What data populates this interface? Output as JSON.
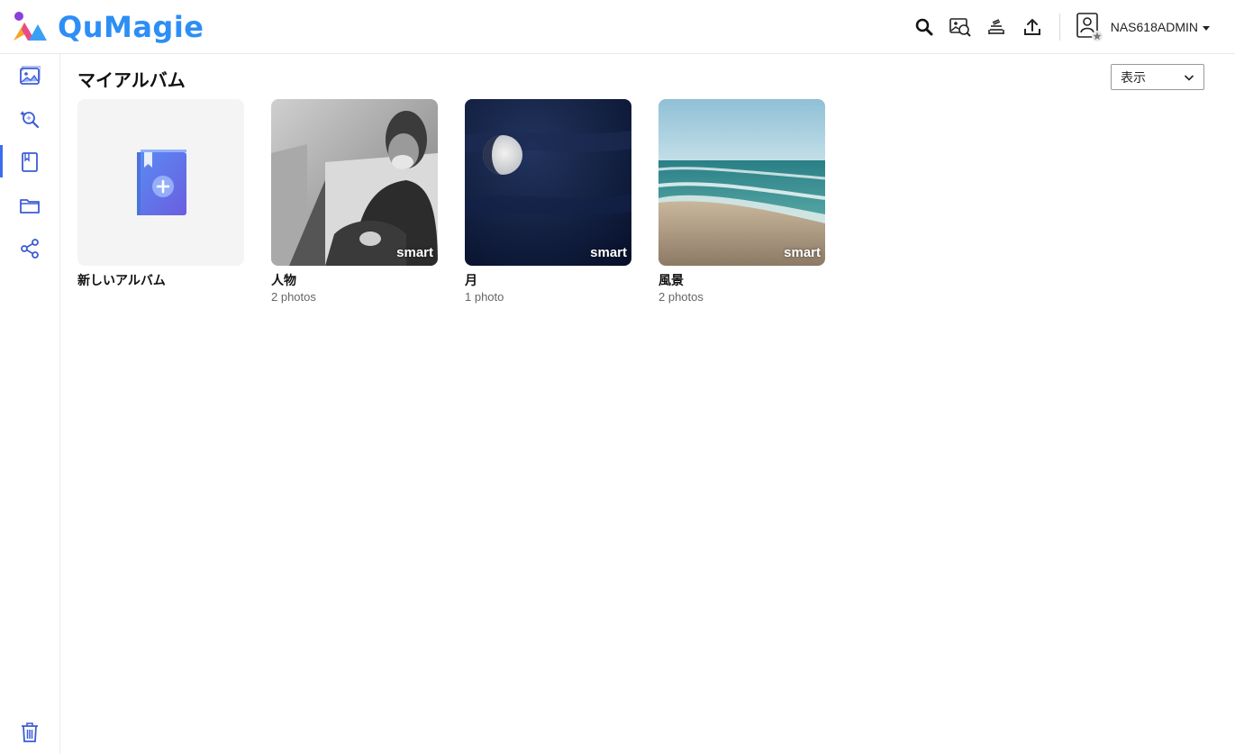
{
  "app": {
    "title": "QuMagie"
  },
  "header": {
    "icons": [
      "search-icon",
      "face-search-icon",
      "stack-icon",
      "upload-icon"
    ],
    "user": {
      "name": "NAS618ADMIN"
    }
  },
  "sidebar": {
    "items": [
      {
        "name": "photos",
        "icon": "photo-icon"
      },
      {
        "name": "things",
        "icon": "magic-search-icon"
      },
      {
        "name": "albums",
        "icon": "album-icon",
        "active": true
      },
      {
        "name": "folders",
        "icon": "folder-icon"
      },
      {
        "name": "sharing",
        "icon": "share-icon"
      }
    ],
    "bottom": {
      "name": "trash",
      "icon": "trash-icon"
    }
  },
  "main": {
    "title": "マイアルバム",
    "view_select": {
      "value": "表示"
    },
    "new_album": {
      "label": "新しいアルバム"
    },
    "albums": [
      {
        "name": "人物",
        "count": "2 photos",
        "badge": "smart"
      },
      {
        "name": "月",
        "count": "1 photo",
        "badge": "smart"
      },
      {
        "name": "風景",
        "count": "2 photos",
        "badge": "smart"
      }
    ]
  },
  "colors": {
    "accent": "#3c6cf0",
    "logo": "#2d8ef5"
  }
}
